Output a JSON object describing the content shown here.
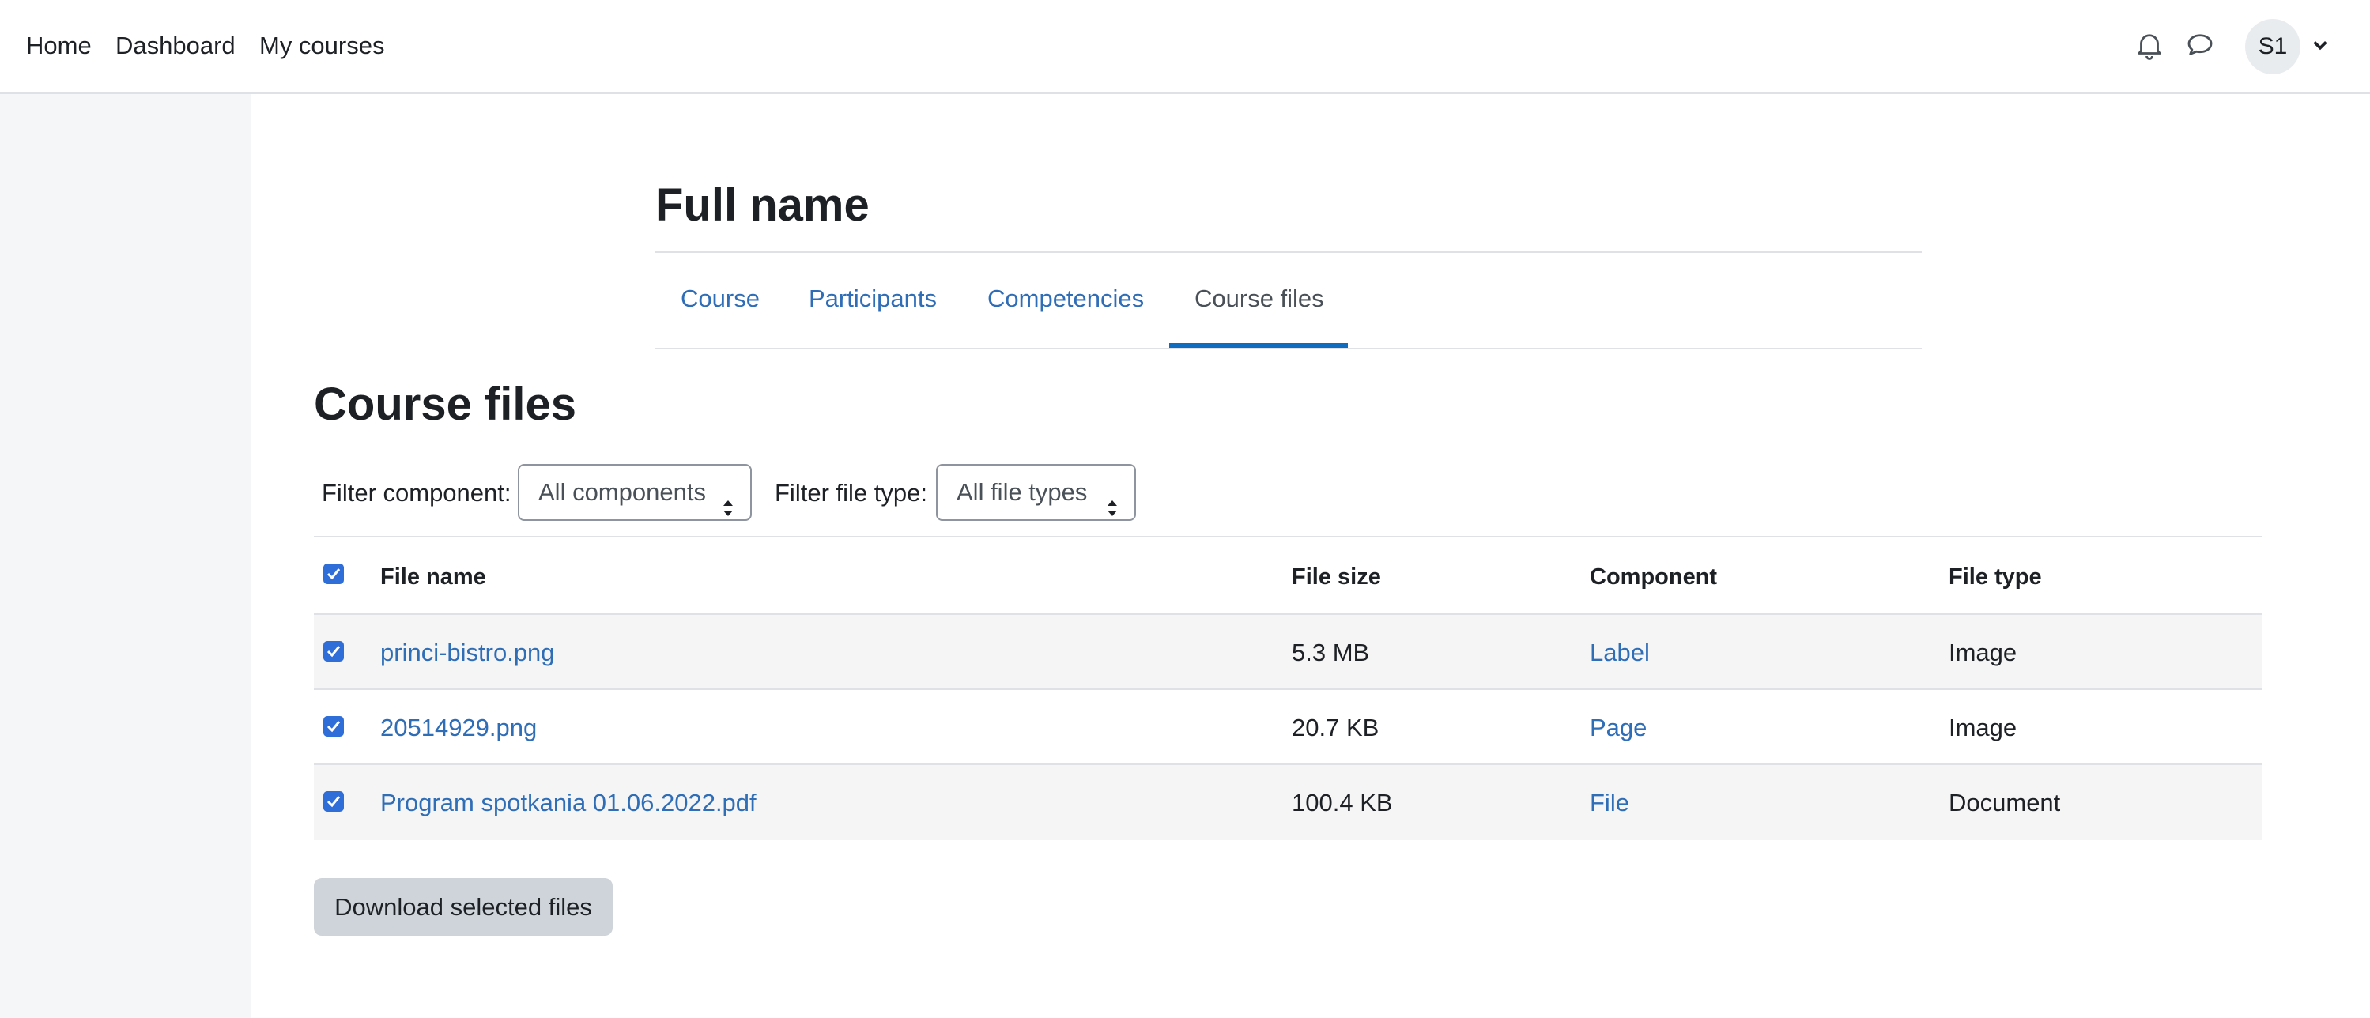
{
  "navbar": {
    "links": [
      "Home",
      "Dashboard",
      "My courses"
    ],
    "avatar_initials": "S1",
    "icons": [
      "bell-icon",
      "chat-bubble-icon",
      "chevron-down-icon"
    ]
  },
  "header": {
    "title": "Full name"
  },
  "tabs": [
    {
      "label": "Course",
      "active": false
    },
    {
      "label": "Participants",
      "active": false
    },
    {
      "label": "Competencies",
      "active": false
    },
    {
      "label": "Course files",
      "active": true
    }
  ],
  "page": {
    "heading": "Course files"
  },
  "filters": {
    "component_label": "Filter component:",
    "component_value": "All components",
    "filetype_label": "Filter file type:",
    "filetype_value": "All file types"
  },
  "table": {
    "headers": [
      "File name",
      "File size",
      "Component",
      "File type"
    ],
    "select_all_checked": true,
    "rows": [
      {
        "checked": true,
        "name": "princi-bistro.png",
        "size": "5.3 MB",
        "component": "Label",
        "type": "Image"
      },
      {
        "checked": true,
        "name": "20514929.png",
        "size": "20.7 KB",
        "component": "Page",
        "type": "Image"
      },
      {
        "checked": true,
        "name": "Program spotkania 01.06.2022.pdf",
        "size": "100.4 KB",
        "component": "File",
        "type": "Document"
      }
    ]
  },
  "actions": {
    "download_label": "Download selected files"
  },
  "colors": {
    "link": "#2f6db7",
    "accent": "#0f6cbf",
    "checkbox": "#2f6dd8",
    "button_bg": "#ced4da"
  }
}
